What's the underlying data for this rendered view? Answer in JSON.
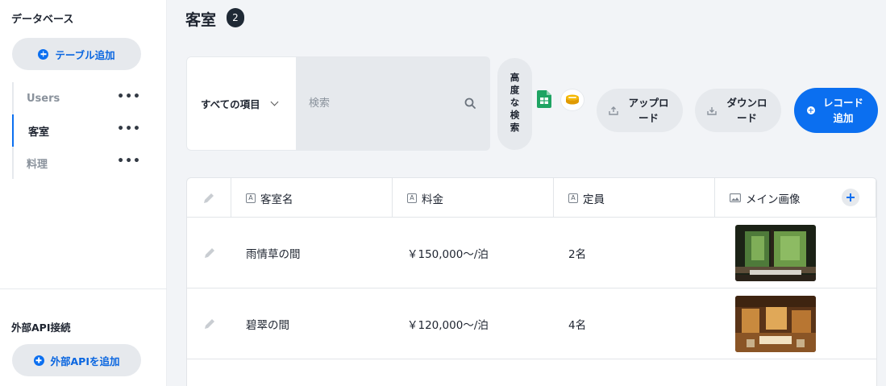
{
  "sidebar": {
    "database_title": "データベース",
    "add_table_label": "テーブル追加",
    "tables": [
      {
        "label": "Users"
      },
      {
        "label": "客室"
      },
      {
        "label": "料理"
      }
    ],
    "more_glyph": "•••",
    "external_api_title": "外部API接続",
    "add_api_label": "外部APIを追加"
  },
  "header": {
    "title": "客室",
    "count": "2"
  },
  "toolbar": {
    "filter_label": "すべての項目",
    "search_placeholder": "検索",
    "advanced_search_label": "高度な検索",
    "upload_label": "アップロード",
    "download_label": "ダウンロード",
    "add_record_label": "レコード追加"
  },
  "table": {
    "columns": [
      {
        "type_glyph": "A",
        "label": "客室名"
      },
      {
        "type_glyph": "A",
        "label": "料金"
      },
      {
        "type_glyph": "A",
        "label": "定員"
      },
      {
        "label": "メイン画像"
      }
    ],
    "rows": [
      {
        "name": "雨情草の間",
        "price": "￥150,000～/泊",
        "capacity": "2名"
      },
      {
        "name": "碧翠の間",
        "price": "￥120,000～/泊",
        "capacity": "4名"
      }
    ]
  },
  "colors": {
    "accent": "#0b6ff0",
    "sidebar_bg": "#ffffff",
    "page_bg": "#f2f4f7",
    "badge_bg": "#1f2935"
  },
  "icons": {
    "search": "search-icon",
    "sheets": "google-sheets-icon",
    "database": "database-connector-icon",
    "upload": "upload-icon",
    "download": "download-icon",
    "edit": "pencil-icon",
    "image_column": "image-icon",
    "add_column": "plus-icon"
  }
}
